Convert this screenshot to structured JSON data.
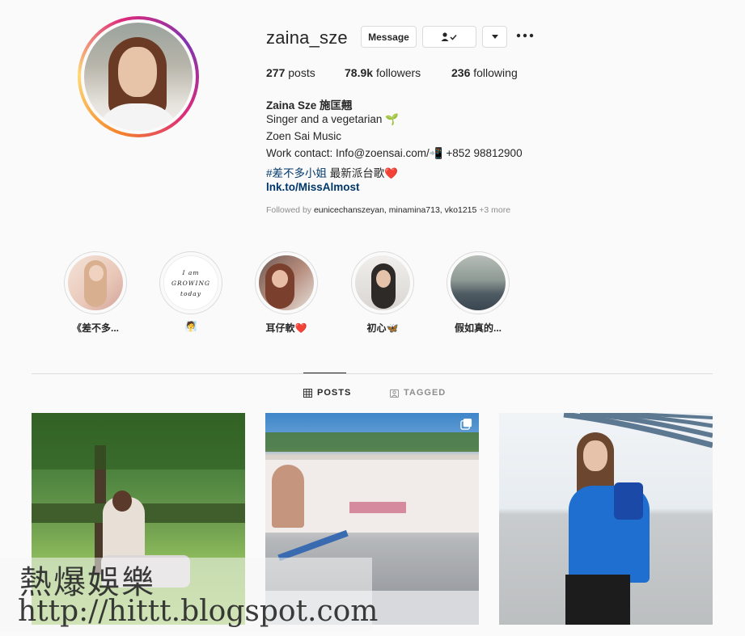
{
  "profile": {
    "username": "zaina_sze",
    "message_label": "Message",
    "following_icon": "person-check-icon",
    "more_icon": "more-options-icon",
    "stats": {
      "posts_count": "277",
      "posts_label": "posts",
      "followers_count": "78.9k",
      "followers_label": "followers",
      "following_count": "236",
      "following_label": "following"
    },
    "bio": {
      "full_name": "Zaina Sze 施匡翹",
      "line1": "Singer and a vegetarian 🌱",
      "line2": "Zoen Sai Music",
      "line3": "Work contact: Info@zoensai.com/📲 +852 98812900",
      "hashtag": "#差不多小姐",
      "line4_rest": " 最新派台歌❤️",
      "link": "lnk.to/MissAlmost"
    },
    "followed_by": {
      "prefix": "Followed by ",
      "names": "eunicechanszeyan, minamina713, vko1215",
      "more": " +3 more"
    }
  },
  "highlights": [
    {
      "label": "《差不多..."
    },
    {
      "label": "🧖",
      "cover_text": "I am GROWING today"
    },
    {
      "label": "耳仔軟❤️"
    },
    {
      "label": "初心🦋"
    },
    {
      "label": "假如真的..."
    }
  ],
  "tabs": {
    "posts": "POSTS",
    "tagged": "TAGGED"
  },
  "watermark": {
    "title": "熱爆娛樂",
    "url": "http://hittt.blogspot.com"
  },
  "colors": {
    "link": "#00376b",
    "muted": "#8e8e8e",
    "border": "#dbdbdb"
  }
}
